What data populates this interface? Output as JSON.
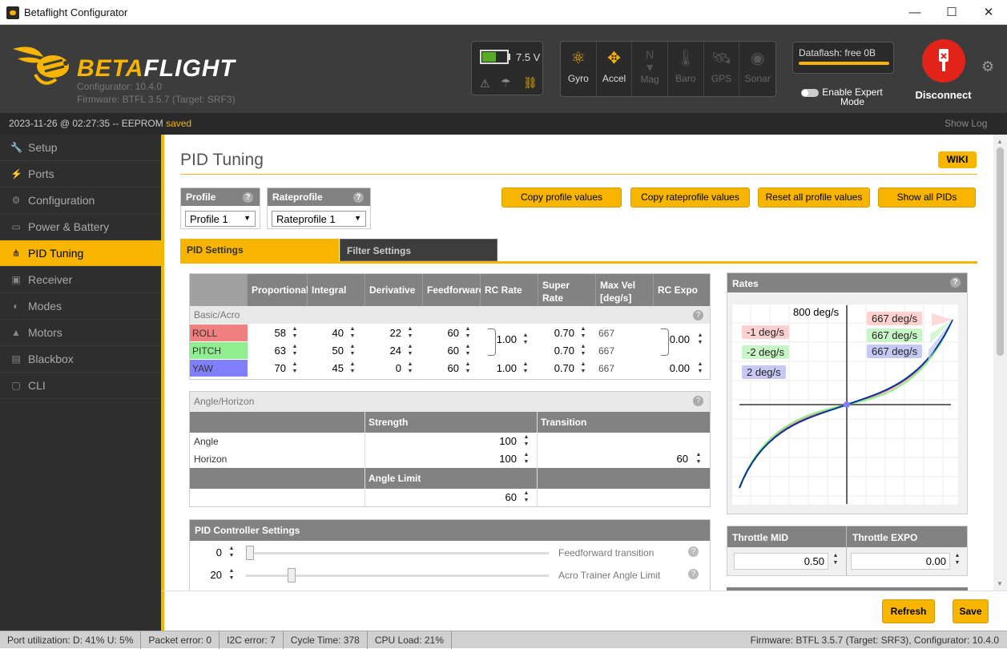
{
  "window": {
    "title": "Betaflight Configurator",
    "minimize": "—",
    "maximize": "☐",
    "close": "✕"
  },
  "header": {
    "brand_beta": "BETA",
    "brand_flight": "FLIGHT",
    "configurator_version": "Configurator: 10.4.0",
    "firmware": "Firmware: BTFL 3.5.7 (Target: SRF3)",
    "battery_voltage": "7.5 V",
    "battery_level": 0.55,
    "sensors": [
      {
        "label": "Gyro",
        "active": true
      },
      {
        "label": "Accel",
        "active": true
      },
      {
        "label": "Mag",
        "active": false
      },
      {
        "label": "Baro",
        "active": false
      },
      {
        "label": "GPS",
        "active": false
      },
      {
        "label": "Sonar",
        "active": false
      }
    ],
    "dataflash": "Dataflash: free 0B",
    "expert_mode": "Enable Expert Mode",
    "disconnect": "Disconnect"
  },
  "status": {
    "log_prefix": "2023-11-26 @ 02:27:35 -- EEPROM ",
    "log_state": "saved",
    "show_log": "Show Log"
  },
  "sidebar": {
    "items": [
      {
        "label": "Setup",
        "icon": "wrench-icon"
      },
      {
        "label": "Ports",
        "icon": "plug-icon"
      },
      {
        "label": "Configuration",
        "icon": "gear-icon"
      },
      {
        "label": "Power & Battery",
        "icon": "battery-icon"
      },
      {
        "label": "PID Tuning",
        "icon": "tree-icon",
        "active": true
      },
      {
        "label": "Receiver",
        "icon": "receiver-icon"
      },
      {
        "label": "Modes",
        "icon": "toggle-icon"
      },
      {
        "label": "Motors",
        "icon": "motor-icon"
      },
      {
        "label": "Blackbox",
        "icon": "blackbox-icon"
      },
      {
        "label": "CLI",
        "icon": "terminal-icon"
      }
    ]
  },
  "page": {
    "title": "PID Tuning",
    "wiki": "WIKI",
    "profile_label": "Profile",
    "profile_value": "Profile 1",
    "rateprofile_label": "Rateprofile",
    "rateprofile_value": "Rateprofile 1",
    "buttons": {
      "copy_profile": "Copy profile values",
      "copy_rateprofile": "Copy rateprofile values",
      "reset_profile": "Reset all profile values",
      "show_all": "Show all PIDs"
    },
    "tabs": {
      "pid": "PID Settings",
      "filter": "Filter Settings"
    },
    "help": "?"
  },
  "pid_table": {
    "columns": [
      "Proportional",
      "Integral",
      "Derivative",
      "Feedforward",
      "RC Rate",
      "Super Rate",
      "Max Vel [deg/s]",
      "RC Expo"
    ],
    "basic_label": "Basic/Acro",
    "rows": [
      {
        "name": "ROLL",
        "color": "#f08080",
        "p": "58",
        "i": "40",
        "d": "22",
        "ff": "60",
        "rcrate": "1.00",
        "super": "0.70",
        "maxvel": "667",
        "expo": "0.00"
      },
      {
        "name": "PITCH",
        "color": "#90ee90",
        "p": "63",
        "i": "50",
        "d": "24",
        "ff": "60",
        "super": "0.70",
        "maxvel": "667"
      },
      {
        "name": "YAW",
        "color": "#8080ff",
        "p": "70",
        "i": "45",
        "d": "0",
        "ff": "60",
        "rcrate": "1.00",
        "super": "0.70",
        "maxvel": "667",
        "expo": "0.00"
      }
    ]
  },
  "angle_horizon": {
    "label": "Angle/Horizon",
    "strength": "Strength",
    "transition": "Transition",
    "angle_label": "Angle",
    "angle_strength": "100",
    "horizon_label": "Horizon",
    "horizon_strength": "100",
    "horizon_transition": "60",
    "angle_limit_label": "Angle Limit",
    "angle_limit": "60"
  },
  "pid_controller": {
    "title": "PID Controller Settings",
    "rows": [
      {
        "value": "0",
        "label": "Feedforward transition"
      },
      {
        "value": "20",
        "label": "Acro Trainer Angle Limit"
      }
    ]
  },
  "rates": {
    "title": "Rates",
    "max": "800 deg/s",
    "left": [
      "-1 deg/s",
      "-2 deg/s",
      "2 deg/s"
    ],
    "right": [
      "667 deg/s",
      "667 deg/s",
      "667 deg/s"
    ],
    "colors": {
      "roll": "#f08080",
      "pitch": "#90ee90",
      "yaw": "#8080ff"
    }
  },
  "throttle": {
    "mid_label": "Throttle MID",
    "mid": "0.50",
    "expo_label": "Throttle EXPO",
    "expo": "0.00"
  },
  "footer": {
    "refresh": "Refresh",
    "save": "Save"
  },
  "bottom": {
    "port": "Port utilization: D: 41% U: 5%",
    "packet": "Packet error: 0",
    "i2c": "I2C error: 7",
    "cycle": "Cycle Time: 378",
    "cpu": "CPU Load: 21%",
    "fw": "Firmware: BTFL 3.5.7 (Target: SRF3), Configurator: 10.4.0"
  }
}
